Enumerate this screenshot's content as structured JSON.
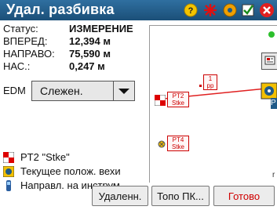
{
  "title": "Удал. разбивка",
  "status": {
    "rows": [
      {
        "label": "Статус:",
        "value": "ИЗМЕРЕНИЕ"
      },
      {
        "label": "ВПЕРЕД:",
        "value": "12,394 м"
      },
      {
        "label": "НАПРАВО:",
        "value": "75,590 м"
      },
      {
        "label": "НАС.:",
        "value": "0,247 м"
      }
    ],
    "edm_label": "EDM",
    "edm_value": "Слежен."
  },
  "legend": {
    "target_point": "PT2 \"Stke\"",
    "current_position": "Текущее полож. вехи",
    "direction": "Направл. на инструм."
  },
  "map": {
    "points": [
      {
        "id": "1",
        "code": "pp"
      },
      {
        "id": "PT2",
        "code": "Stke"
      },
      {
        "id": "PT4",
        "code": "Stke"
      }
    ],
    "edge_letter_right": "P",
    "edge_letter_bottom": "r"
  },
  "buttons": {
    "remote": "Удаленн.",
    "topo": "Топо ПК...",
    "done": "Готово"
  },
  "colors": {
    "titlebar": "#1f5a88",
    "done_text": "#d00000",
    "point_red": "#cc0000",
    "line_red": "#e02020"
  },
  "icons": {
    "help": "help-icon",
    "satellite": "satellite-icon",
    "gear": "settings-icon",
    "check": "check-icon",
    "close": "close-icon"
  }
}
